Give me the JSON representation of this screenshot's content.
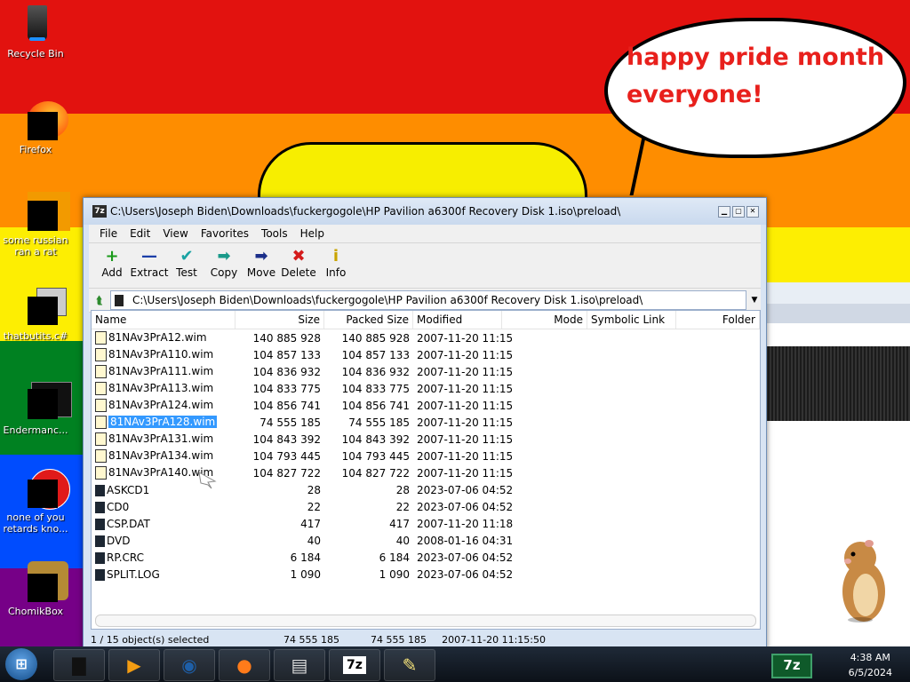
{
  "desktop": {
    "stripe_colors": [
      "#e2120f",
      "#fe8d00",
      "#fdee02",
      "#008121",
      "#004cfe",
      "#760087"
    ],
    "icons": [
      {
        "label": "Recycle Bin",
        "icon": "recycle-bin-icon"
      },
      {
        "label": "Firefox",
        "icon": "firefox-icon"
      },
      {
        "label": "some russian ran a rat",
        "icon": "app-icon"
      },
      {
        "label": "thatbutits.c#",
        "icon": "file-stack-icon"
      },
      {
        "label": "Endermanc...",
        "icon": "terminal-icon"
      },
      {
        "label": "none of you retards kno...",
        "icon": "opera-icon"
      },
      {
        "label": "ChomikBox",
        "icon": "chomikbox-icon"
      }
    ],
    "bubble_text_line1": "happy pride month",
    "bubble_text_line2": "everyone!"
  },
  "window": {
    "title": "C:\\Users\\Joseph Biden\\Downloads\\fuckergogole\\HP Pavilion a6300f Recovery Disk 1.iso\\preload\\",
    "app_icon": "7z",
    "menu": [
      "File",
      "Edit",
      "View",
      "Favorites",
      "Tools",
      "Help"
    ],
    "toolbar": [
      {
        "label": "Add",
        "icon": "plus-icon",
        "glyph": "+",
        "color": "#1a9a1a"
      },
      {
        "label": "Extract",
        "icon": "minus-icon",
        "glyph": "—",
        "color": "#1b3fa8"
      },
      {
        "label": "Test",
        "icon": "check-icon",
        "glyph": "✔",
        "color": "#1aa3a3"
      },
      {
        "label": "Copy",
        "icon": "copy-arrow-icon",
        "glyph": "➡",
        "color": "#1a9a8a"
      },
      {
        "label": "Move",
        "icon": "move-arrow-icon",
        "glyph": "➡",
        "color": "#1b2f8a"
      },
      {
        "label": "Delete",
        "icon": "delete-x-icon",
        "glyph": "✖",
        "color": "#d41b1b"
      },
      {
        "label": "Info",
        "icon": "info-icon",
        "glyph": "i",
        "color": "#c9a400"
      }
    ],
    "address": "C:\\Users\\Joseph Biden\\Downloads\\fuckergogole\\HP Pavilion a6300f Recovery Disk 1.iso\\preload\\",
    "columns": [
      "Name",
      "Size",
      "Packed Size",
      "Modified",
      "Mode",
      "Symbolic Link",
      "Folder"
    ],
    "files": [
      {
        "name": "81NAv3PrA12.wim",
        "size": "140 885 928",
        "packed": "140 885 928",
        "modified": "2007-11-20 11:15",
        "type": "wim",
        "selected": false
      },
      {
        "name": "81NAv3PrA110.wim",
        "size": "104 857 133",
        "packed": "104 857 133",
        "modified": "2007-11-20 11:15",
        "type": "wim",
        "selected": false
      },
      {
        "name": "81NAv3PrA111.wim",
        "size": "104 836 932",
        "packed": "104 836 932",
        "modified": "2007-11-20 11:15",
        "type": "wim",
        "selected": false
      },
      {
        "name": "81NAv3PrA113.wim",
        "size": "104 833 775",
        "packed": "104 833 775",
        "modified": "2007-11-20 11:15",
        "type": "wim",
        "selected": false
      },
      {
        "name": "81NAv3PrA124.wim",
        "size": "104 856 741",
        "packed": "104 856 741",
        "modified": "2007-11-20 11:15",
        "type": "wim",
        "selected": false
      },
      {
        "name": "81NAv3PrA128.wim",
        "size": "74 555 185",
        "packed": "74 555 185",
        "modified": "2007-11-20 11:15",
        "type": "wim",
        "selected": true
      },
      {
        "name": "81NAv3PrA131.wim",
        "size": "104 843 392",
        "packed": "104 843 392",
        "modified": "2007-11-20 11:15",
        "type": "wim",
        "selected": false
      },
      {
        "name": "81NAv3PrA134.wim",
        "size": "104 793 445",
        "packed": "104 793 445",
        "modified": "2007-11-20 11:15",
        "type": "wim",
        "selected": false
      },
      {
        "name": "81NAv3PrA140.wim",
        "size": "104 827 722",
        "packed": "104 827 722",
        "modified": "2007-11-20 11:15",
        "type": "wim",
        "selected": false
      },
      {
        "name": "ASKCD1",
        "size": "28",
        "packed": "28",
        "modified": "2023-07-06 04:52",
        "type": "file",
        "selected": false
      },
      {
        "name": "CD0",
        "size": "22",
        "packed": "22",
        "modified": "2023-07-06 04:52",
        "type": "file",
        "selected": false
      },
      {
        "name": "CSP.DAT",
        "size": "417",
        "packed": "417",
        "modified": "2007-11-20 11:18",
        "type": "file",
        "selected": false
      },
      {
        "name": "DVD",
        "size": "40",
        "packed": "40",
        "modified": "2008-01-16 04:31",
        "type": "file",
        "selected": false
      },
      {
        "name": "RP.CRC",
        "size": "6 184",
        "packed": "6 184",
        "modified": "2023-07-06 04:52",
        "type": "file",
        "selected": false
      },
      {
        "name": "SPLIT.LOG",
        "size": "1 090",
        "packed": "1 090",
        "modified": "2023-07-06 04:52",
        "type": "file",
        "selected": false
      }
    ],
    "status": {
      "selection": "1 / 15 object(s) selected",
      "size": "74 555 185",
      "packed": "74 555 185",
      "modified": "2007-11-20 11:15:50"
    }
  },
  "taskbar": {
    "buttons": [
      {
        "icon": "hard-drive-icon"
      },
      {
        "icon": "media-player-icon"
      },
      {
        "icon": "globe-icon"
      },
      {
        "icon": "firefox-icon"
      },
      {
        "icon": "terminal-icon"
      },
      {
        "icon": "7zip-icon",
        "label": "7z"
      },
      {
        "icon": "notepad-icon"
      }
    ],
    "tray_label": "7z",
    "time": "4:38 AM",
    "date": "6/5/2024"
  }
}
